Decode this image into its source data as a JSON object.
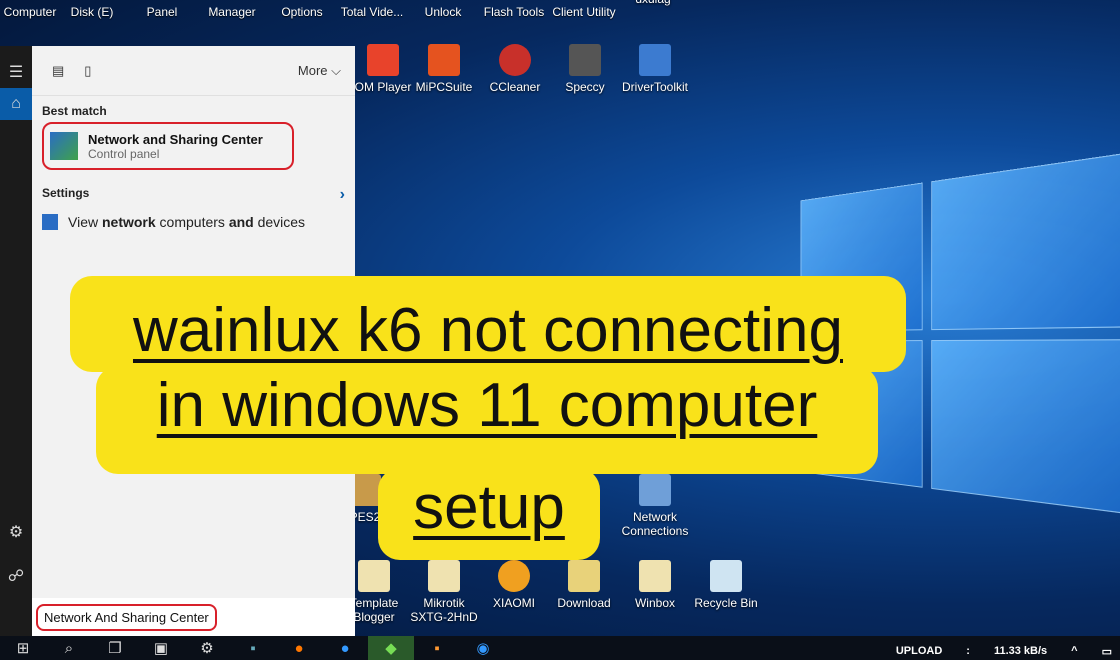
{
  "desktop_top_icons": [
    "Computer",
    "Disk (E)",
    "Panel",
    "Manager",
    "Options",
    "Total Vide...",
    "Unlock",
    "Flash Tools",
    "Client Utility",
    "dxdiag"
  ],
  "desktop_row2": [
    "OM Player",
    "MiPCSuite",
    "CCleaner",
    "Speccy",
    "DriverToolkit"
  ],
  "desktop_mid": [
    "PES2",
    "Network Connections"
  ],
  "desktop_bottom": [
    "Template Blogger",
    "Mikrotik SXTG-2HnD",
    "XIAOMI",
    "Download",
    "Winbox",
    "Recycle Bin"
  ],
  "start_menu": {
    "more_label": "More",
    "best_match_header": "Best match",
    "best_match_title": "Network and Sharing Center",
    "best_match_subtitle": "Control panel",
    "settings_header": "Settings",
    "settings_item_pre": "View ",
    "settings_item_b1": "network",
    "settings_item_mid": " computers ",
    "settings_item_b2": "and",
    "settings_item_post": " devices",
    "search_value": "Network And Sharing Center"
  },
  "banner": {
    "line1": "wainlux k6 not connecting",
    "line2": "in windows 11 computer",
    "line3": "setup"
  },
  "tray": {
    "upload_label": "UPLOAD",
    "separator": ":",
    "upload_speed": "11.33 kB/s"
  },
  "colors": {
    "highlight": "#d8202a",
    "banner_bg": "#f9e21a"
  }
}
